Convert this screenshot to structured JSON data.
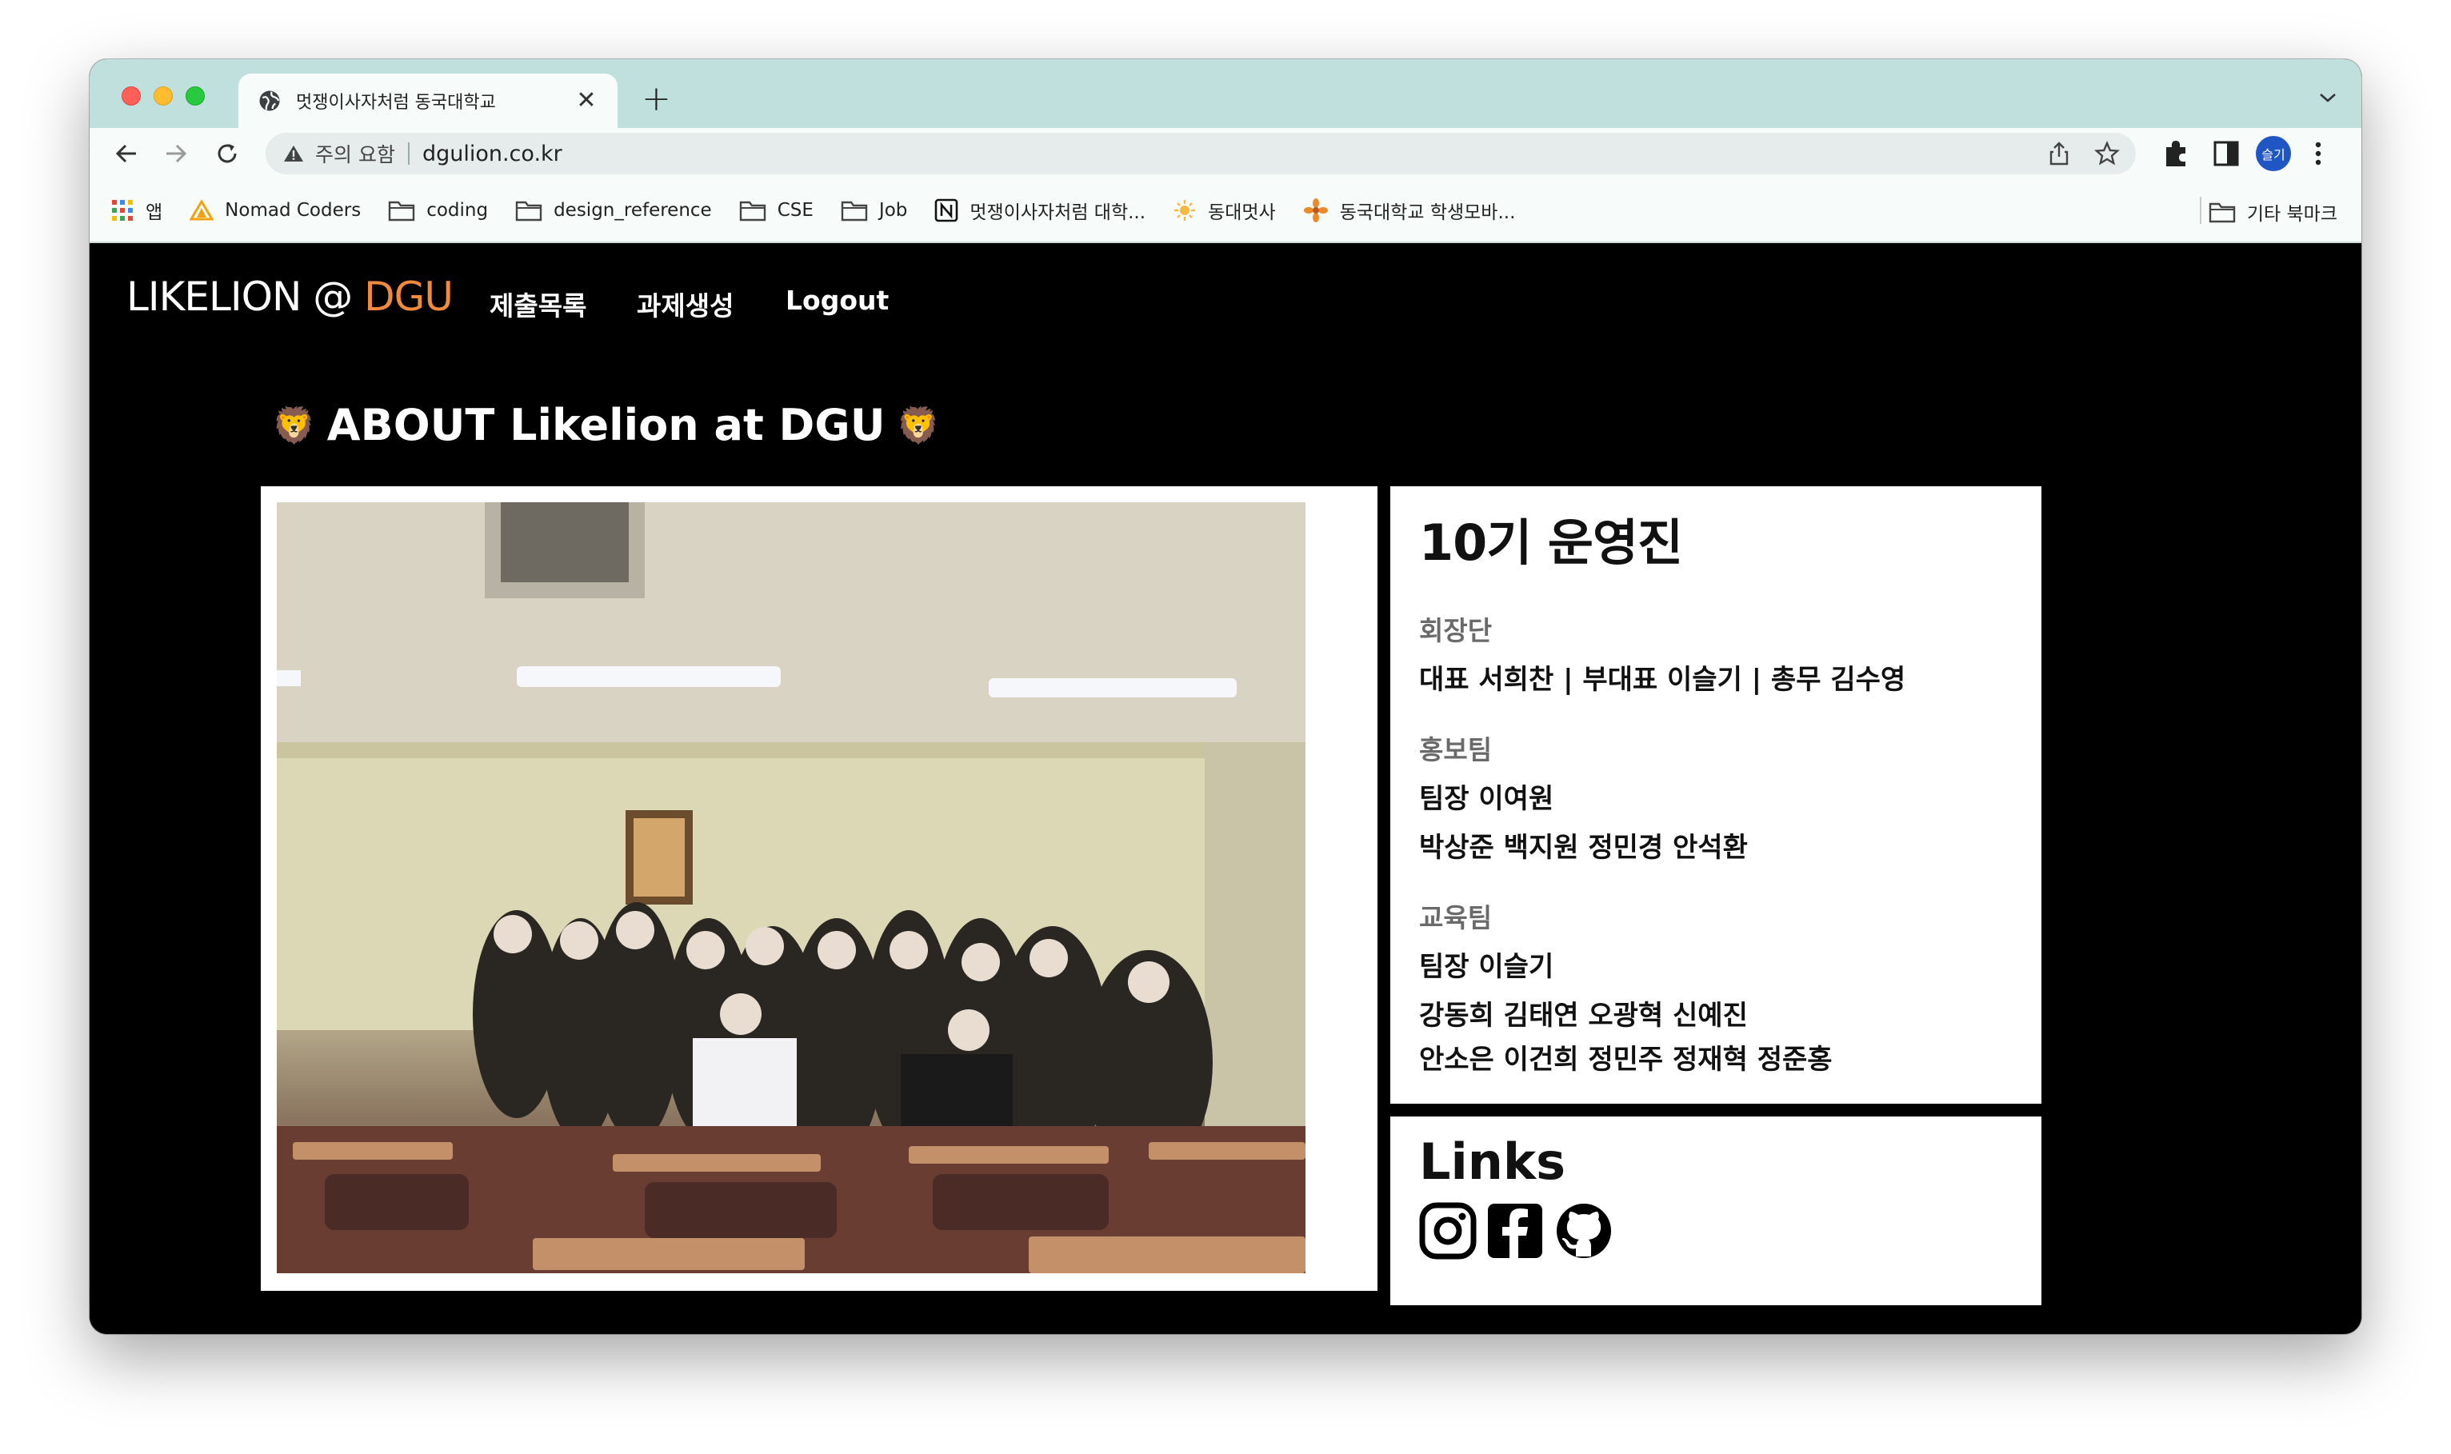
{
  "browser": {
    "tab_title": "멋쟁이사자처럼 동국대학교",
    "address_warning": "주의 요함",
    "url": "dgulion.co.kr",
    "profile_label": "슬기",
    "bookmarks": [
      {
        "label": "앱",
        "icon": "apps-grid-icon"
      },
      {
        "label": "Nomad Coders",
        "icon": "nomad-icon"
      },
      {
        "label": "coding",
        "icon": "folder-icon"
      },
      {
        "label": "design_reference",
        "icon": "folder-icon"
      },
      {
        "label": "CSE",
        "icon": "folder-icon"
      },
      {
        "label": "Job",
        "icon": "folder-icon"
      },
      {
        "label": "멋쟁이사자처럼 대학...",
        "icon": "notion-icon"
      },
      {
        "label": "동대멋사",
        "icon": "sun-icon"
      },
      {
        "label": "동국대학교 학생모바...",
        "icon": "flower-icon"
      }
    ],
    "other_bookmarks": "기타 북마크"
  },
  "site": {
    "brand_prefix": "LIKELION @ ",
    "brand_accent": "DGU",
    "nav": [
      "제출목록",
      "과제생성",
      "Logout"
    ],
    "about_title": "ABOUT Likelion at DGU",
    "lion_emoji": "🦁"
  },
  "staff": {
    "title": "10기 운영진",
    "sections": [
      {
        "label": "회장단",
        "lines": [
          "대표 서희찬 | 부대표 이슬기 | 총무 김수영"
        ]
      },
      {
        "label": "홍보팀",
        "lines": [
          "팀장 이여원",
          "박상준 백지원 정민경 안석환"
        ]
      },
      {
        "label": "교육팀",
        "lines": [
          "팀장 이슬기",
          "강동희 김태연 오광혁 신예진",
          "안소은 이건희 정민주 정재혁 정준홍"
        ]
      }
    ]
  },
  "links": {
    "title": "Links",
    "icons": [
      "instagram-icon",
      "facebook-icon",
      "github-icon"
    ]
  },
  "colors": {
    "accent": "#f08a3c",
    "tabstrip": "#bfe0dc",
    "page_bg": "#000000"
  }
}
